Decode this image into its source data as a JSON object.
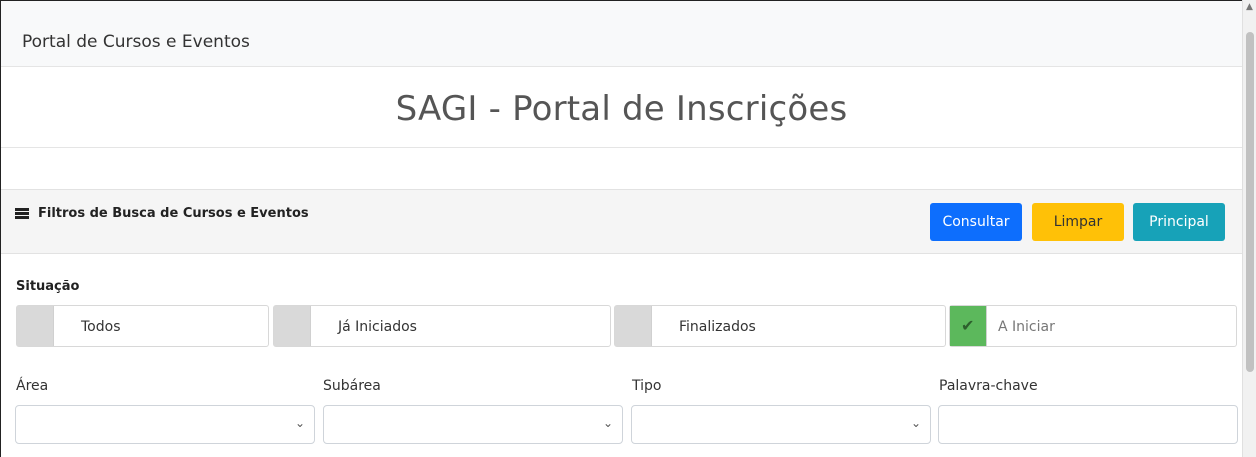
{
  "navbar": {
    "brand": "Portal de Cursos e Eventos"
  },
  "page": {
    "title": "SAGI - Portal de Inscrições"
  },
  "filters": {
    "header_title": "Filtros de Busca de Cursos e Eventos",
    "buttons": {
      "consultar": "Consultar",
      "limpar": "Limpar",
      "principal": "Principal"
    },
    "situacao": {
      "label": "Situação",
      "options": [
        {
          "label": "Todos",
          "checked": false
        },
        {
          "label": "Já Iniciados",
          "checked": false
        },
        {
          "label": "Finalizados",
          "checked": false
        },
        {
          "label": "A Iniciar",
          "checked": true
        }
      ]
    },
    "fields": {
      "area": {
        "label": "Área",
        "value": ""
      },
      "subarea": {
        "label": "Subárea",
        "value": ""
      },
      "tipo": {
        "label": "Tipo",
        "value": ""
      },
      "palavra_chave": {
        "label": "Palavra-chave",
        "value": ""
      }
    }
  },
  "colors": {
    "primary": "#0d6efd",
    "warning": "#ffc107",
    "info": "#17a2b8",
    "success": "#5cb85c"
  }
}
